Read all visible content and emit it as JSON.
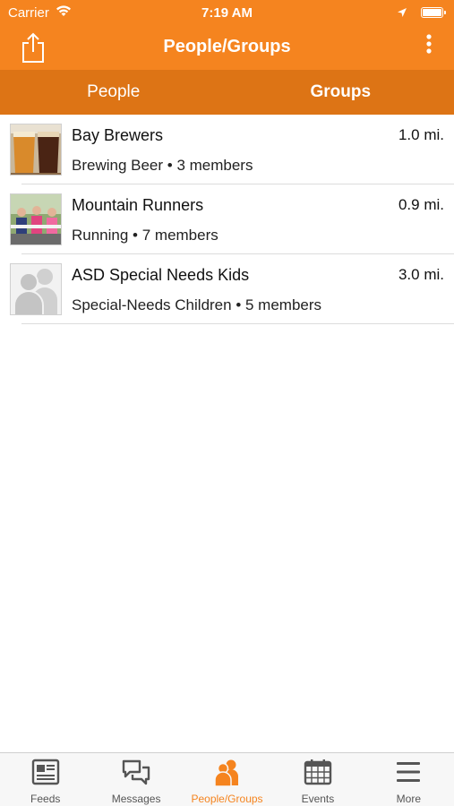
{
  "status_bar": {
    "carrier": "Carrier",
    "time": "7:19 AM"
  },
  "nav": {
    "title": "People/Groups",
    "share_icon": "share-icon",
    "more_icon": "more-vertical-icon"
  },
  "segments": [
    {
      "label": "People",
      "active": false
    },
    {
      "label": "Groups",
      "active": true
    }
  ],
  "groups": [
    {
      "name": "Bay Brewers",
      "subtitle": "Brewing Beer • 3 members",
      "distance": "1.0 mi.",
      "thumb": "beer-photo"
    },
    {
      "name": "Mountain Runners",
      "subtitle": "Running • 7 members",
      "distance": "0.9 mi.",
      "thumb": "runners-photo"
    },
    {
      "name": "ASD Special Needs Kids",
      "subtitle": "Special-Needs Children • 5 members",
      "distance": "3.0 mi.",
      "thumb": "group-placeholder-icon"
    }
  ],
  "tabs": [
    {
      "label": "Feeds",
      "icon": "newspaper-icon",
      "active": false
    },
    {
      "label": "Messages",
      "icon": "chat-bubbles-icon",
      "active": false
    },
    {
      "label": "People/Groups",
      "icon": "people-icon",
      "active": true
    },
    {
      "label": "Events",
      "icon": "calendar-icon",
      "active": false
    },
    {
      "label": "More",
      "icon": "hamburger-menu-icon",
      "active": false
    }
  ],
  "colors": {
    "accent": "#f5841f",
    "segment_bg": "#dd7415",
    "tab_inactive": "#555555"
  }
}
